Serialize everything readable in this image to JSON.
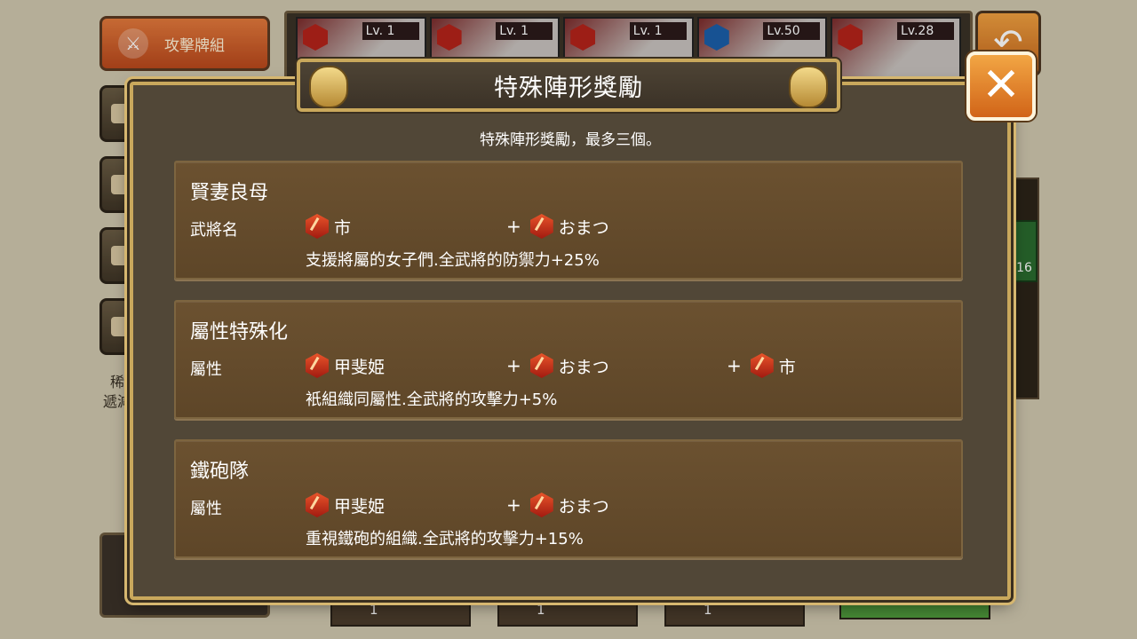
{
  "background": {
    "deck_button_label": "攻擊牌組",
    "side_text": "稀\n遞減",
    "cards": [
      {
        "level": "Lv. 1",
        "element": "fire"
      },
      {
        "level": "Lv. 1",
        "element": "fire"
      },
      {
        "level": "Lv. 1",
        "element": "fire"
      },
      {
        "level": "Lv.50",
        "element": "water"
      },
      {
        "level": "Lv.28",
        "element": "fire"
      }
    ],
    "right_badge_value": "16",
    "bottom_slots": [
      "1",
      "1",
      "1"
    ]
  },
  "modal": {
    "title": "特殊陣形獎勵",
    "subtitle": "特殊陣形獎勵，最多三個。",
    "close_icon": "close-x",
    "bonuses": [
      {
        "name": "賢妻良母",
        "label": "武將名",
        "members": [
          "市",
          "おまつ"
        ],
        "effect": "支援將屬的女子們.全武將的防禦力+25%"
      },
      {
        "name": "屬性特殊化",
        "label": "屬性",
        "members": [
          "甲斐姫",
          "おまつ",
          "市"
        ],
        "effect": "衹組織同屬性.全武將的攻擊力+5%"
      },
      {
        "name": "鐵砲隊",
        "label": "屬性",
        "members": [
          "甲斐姫",
          "おまつ"
        ],
        "effect": "重視鐵砲的組織.全武將的攻擊力+15%"
      }
    ],
    "plus_sign": "+"
  }
}
